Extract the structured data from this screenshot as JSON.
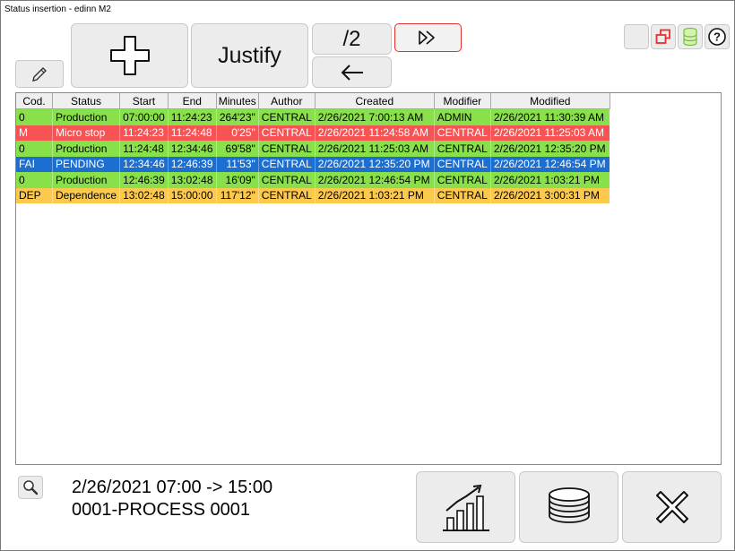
{
  "window": {
    "title": "Status insertion - edinn M2"
  },
  "toolbar": {
    "justify_label": "Justify",
    "page_label": "/2"
  },
  "table": {
    "columns": [
      "Cod.",
      "Status",
      "Start",
      "End",
      "Minutes",
      "Author",
      "Created",
      "Modifier",
      "Modified"
    ],
    "rows": [
      {
        "code": "0",
        "status": "Production",
        "start": "07:00:00",
        "end": "11:24:23",
        "minutes": "264'23\"",
        "author": "CENTRAL",
        "created": "2/26/2021 7:00:13 AM",
        "modifier": "ADMIN",
        "modified": "2/26/2021 11:30:39 AM",
        "color": "#88e04a",
        "text": "#000000"
      },
      {
        "code": "M",
        "status": "Micro stop",
        "start": "11:24:23",
        "end": "11:24:48",
        "minutes": "0'25\"",
        "author": "CENTRAL",
        "created": "2/26/2021 11:24:58 AM",
        "modifier": "CENTRAL",
        "modified": "2/26/2021 11:25:03 AM",
        "color": "#f65454",
        "text": "#ffffff"
      },
      {
        "code": "0",
        "status": "Production",
        "start": "11:24:48",
        "end": "12:34:46",
        "minutes": "69'58\"",
        "author": "CENTRAL",
        "created": "2/26/2021 11:25:03 AM",
        "modifier": "CENTRAL",
        "modified": "2/26/2021 12:35:20 PM",
        "color": "#88e04a",
        "text": "#000000"
      },
      {
        "code": "FAI",
        "status": "PENDING",
        "start": "12:34:46",
        "end": "12:46:39",
        "minutes": "11'53\"",
        "author": "CENTRAL",
        "created": "2/26/2021 12:35:20 PM",
        "modifier": "CENTRAL",
        "modified": "2/26/2021 12:46:54 PM",
        "color": "#1c6fd0",
        "text": "#ffffff"
      },
      {
        "code": "0",
        "status": "Production",
        "start": "12:46:39",
        "end": "13:02:48",
        "minutes": "16'09\"",
        "author": "CENTRAL",
        "created": "2/26/2021 12:46:54 PM",
        "modifier": "CENTRAL",
        "modified": "2/26/2021 1:03:21 PM",
        "color": "#88e04a",
        "text": "#000000"
      },
      {
        "code": "DEP",
        "status": "Dependence",
        "start": "13:02:48",
        "end": "15:00:00",
        "minutes": "117'12\"",
        "author": "CENTRAL",
        "created": "2/26/2021 1:03:21 PM",
        "modifier": "CENTRAL",
        "modified": "2/26/2021 3:00:31 PM",
        "color": "#fcc94c",
        "text": "#000000"
      }
    ]
  },
  "info": {
    "range": "2/26/2021 07:00 -> 15:00",
    "process": "0001-PROCESS 0001"
  },
  "icons": {
    "add": "plus-icon",
    "next": "double-chevron-right-icon",
    "back": "arrow-left-icon",
    "edit": "pencil-icon",
    "search": "magnifier-icon",
    "chart": "bar-chart-icon",
    "coins": "coin-stack-icon",
    "close": "close-x-icon",
    "help": "help-icon"
  }
}
